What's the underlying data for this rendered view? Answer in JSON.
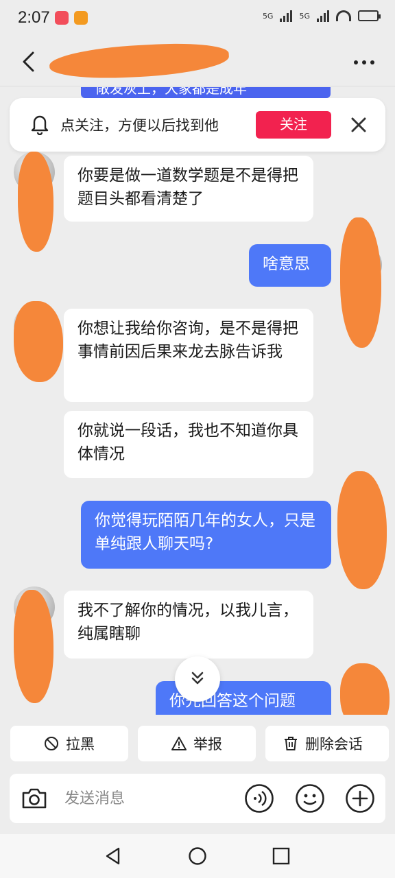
{
  "status_bar": {
    "time": "2:07",
    "network_1": "5G",
    "network_2": "5G"
  },
  "header": {
    "back_icon": "chevron-left-icon",
    "more_icon": "more-dots-icon"
  },
  "chat": {
    "peek_text": "敞发灰上，大家都是成年",
    "follow_banner": {
      "text": "点关注，方便以后找到他",
      "button": "关注",
      "accent_color": "#f2224f"
    },
    "messages": [
      {
        "side": "in",
        "text": "你要是做一道数学题是不是得把题目头都看清楚了"
      },
      {
        "side": "out",
        "text": "啥意思"
      },
      {
        "side": "in",
        "text": "你想让我给你咨询，是不是得把事情前因后果来龙去脉告诉我"
      },
      {
        "side": "in",
        "text": "你就说一段话，我也不知道你具体情况"
      },
      {
        "side": "out",
        "text": "你觉得玩陌陌几年的女人，只是单纯跟人聊天吗?"
      },
      {
        "side": "in",
        "text": "我不了解你的情况，以我儿言，纯属瞎聊"
      },
      {
        "side": "out",
        "text": "你先回答这个问题"
      }
    ],
    "outgoing_color": "#4e78f8"
  },
  "actions": {
    "block": "拉黑",
    "report": "举报",
    "delete": "删除会话"
  },
  "input_bar": {
    "placeholder": "发送消息"
  }
}
